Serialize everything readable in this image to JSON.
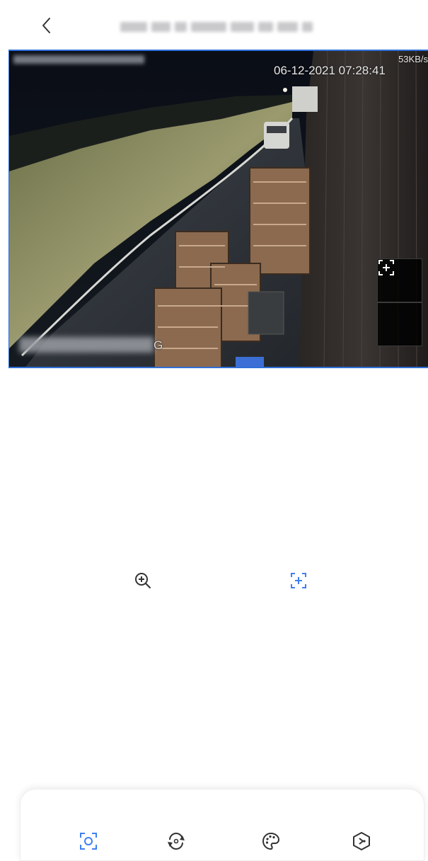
{
  "header": {
    "back_icon": "chevron-left-icon",
    "title": "",
    "title_note": "blurred device name"
  },
  "video": {
    "timestamp": "06-12-2021 07:28:41",
    "bitrate": "53KB/s",
    "bottom_osd_suffix": "G",
    "zoom_in_icon": "frame-plus-icon",
    "zoom_out_icon": "frame-minus-icon"
  },
  "controls": {
    "digital_zoom_icon": "zoom-in-icon",
    "frame_zoom_icon": "frame-plus-icon"
  },
  "toolbar": {
    "items": [
      {
        "icon": "snapshot-icon",
        "active": true
      },
      {
        "icon": "rotate-icon",
        "active": false
      },
      {
        "icon": "palette-icon",
        "active": false
      },
      {
        "icon": "ptz-icon",
        "active": false
      }
    ]
  },
  "colors": {
    "accent": "#3f7ff2",
    "icon_gray": "#333333",
    "video_border": "#2f6fd8"
  }
}
